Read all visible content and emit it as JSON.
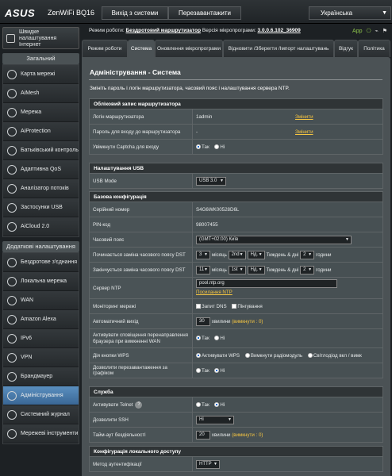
{
  "header": {
    "brand": "ASUS",
    "model": "ZenWiFi BQ16",
    "logout_label": "Вихід з системи",
    "reboot_label": "Перезавантажити",
    "language": "Українська"
  },
  "status": {
    "mode_prefix": "Режим роботи:",
    "mode_value": "Бездротовий маршрутизатор",
    "fw_prefix": "Версія мікропрограми:",
    "fw_value": "3.0.0.6.102_36909",
    "app_label": "App",
    "ssid_label": "SSID:"
  },
  "sidebar": {
    "quick_setup": "Швидке налаштування Інтернет",
    "general_header": "Загальний",
    "general_items": [
      {
        "label": "Карта мережі"
      },
      {
        "label": "AiMesh"
      },
      {
        "label": "Мережа"
      },
      {
        "label": "AiProtection"
      },
      {
        "label": "Батьківський контроль"
      },
      {
        "label": "Адаптивна QoS"
      },
      {
        "label": "Аналізатор потоків"
      },
      {
        "label": "Застосунки USB"
      },
      {
        "label": "AiCloud 2.0"
      }
    ],
    "advanced_header": "Додаткові налаштування",
    "advanced_items": [
      {
        "label": "Бездротове з'єднання"
      },
      {
        "label": "Локальна мережа"
      },
      {
        "label": "WAN"
      },
      {
        "label": "Amazon Alexa"
      },
      {
        "label": "IPv6"
      },
      {
        "label": "VPN"
      },
      {
        "label": "Брандмауер"
      },
      {
        "label": "Адміністрування"
      },
      {
        "label": "Системний журнал"
      },
      {
        "label": "Мережеві інструменти"
      }
    ]
  },
  "tabs": [
    {
      "label": "Режим роботи"
    },
    {
      "label": "Система"
    },
    {
      "label": "Оновлення мікропрограми"
    },
    {
      "label": "Відновити /Зберегти /Імпорт налаштувань"
    },
    {
      "label": "Відгук"
    },
    {
      "label": "Політика"
    }
  ],
  "main": {
    "title": "Адміністрування - Система",
    "description": "Змініть пароль і логін маршрутизатора, часовий пояс і налаштування сервера NTP.",
    "sections": {
      "account": {
        "header": "Обліковий запис маршрутизатора",
        "login_label": "Логін маршрутизатора",
        "login_value": "1admin",
        "login_change": "Змінити",
        "password_label": "Пароль для входу до маршрутизатора",
        "password_value": "-",
        "password_change": "Змінити",
        "captcha_label": "Увімкнути Captcha для входу",
        "yes": "Так",
        "no": "Ні"
      },
      "usb": {
        "header": "Налаштування USB",
        "mode_label": "USB Mode",
        "mode_value": "USB 3.0"
      },
      "basic": {
        "header": "Базова конфігурація",
        "serial_label": "Серійний номер",
        "serial_value": "S4G6WK00528D6L",
        "pin_label": "PIN-код",
        "pin_value": "98007455",
        "tz_label": "Часовий пояс",
        "tz_value": "(GMT+02:00) Київ",
        "dst_start_label": "Починається заміна часового поясу DST",
        "dst_start": {
          "month": "3",
          "month_unit": "місяць",
          "week": "2nd",
          "day": "Нд.",
          "day_unit": "Тиждень & дні",
          "hour": "2",
          "hour_unit": "години"
        },
        "dst_end_label": "Закінчується заміна часового поясу DST",
        "dst_end": {
          "month": "11",
          "month_unit": "місяць",
          "week": "1st",
          "day": "Нд.",
          "day_unit": "Тиждень & дні",
          "hour": "2",
          "hour_unit": "години"
        },
        "ntp_label": "Сервер NTP",
        "ntp_value": "pool.ntp.org",
        "ntp_link": "Посилання NTP",
        "monitor_label": "Моніторинг мережі",
        "monitor_dns": "Запит DNS",
        "monitor_ping": "Пінгування",
        "logout_label": "Автоматичний вихід",
        "logout_value": "30",
        "logout_unit": "хвилини",
        "logout_hint": "(вимкнути : 0)",
        "redirect_label": "Активувати сповіщення перенаправлення браузера при вимкненні WAN",
        "wps_label": "Дія кнопки WPS",
        "wps_opt1": "Активувати WPS",
        "wps_opt2": "Вимкнути радіомодуль",
        "wps_opt3": "Світлодіод вкл / вимк",
        "sched_label": "Дозволити перезавантаження за графіком",
        "yes": "Так",
        "no": "Ні"
      },
      "service": {
        "header": "Служба",
        "telnet_label": "Активувати Telnet",
        "ssh_label": "Дозволити SSH",
        "ssh_value": "Ні",
        "idle_label": "Тайм-аут бездіяльності",
        "idle_value": "20",
        "idle_unit": "хвилини",
        "idle_hint": "(вимкнути : 0)",
        "yes": "Так",
        "no": "Ні"
      },
      "local": {
        "header": "Конфігурація локального доступу",
        "auth_label": "Метод аутентифікації",
        "auth_value": "HTTP"
      }
    }
  }
}
